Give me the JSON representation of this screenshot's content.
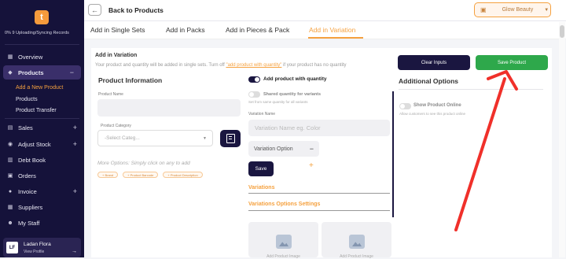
{
  "sidebar": {
    "logo_letter": "t",
    "sync_status": "0% 9 Uploading/Syncing Records",
    "items": [
      {
        "label": "Overview",
        "icon": "dashboard-icon"
      },
      {
        "label": "Products",
        "icon": "box-icon",
        "toggle": "−"
      },
      {
        "label": "Sales",
        "icon": "receipt-icon",
        "toggle": "+"
      },
      {
        "label": "Adjust Stock",
        "icon": "adjust-icon",
        "toggle": "+"
      },
      {
        "label": "Debt Book",
        "icon": "book-icon"
      },
      {
        "label": "Orders",
        "icon": "cart-icon"
      },
      {
        "label": "Invoice",
        "icon": "invoice-icon",
        "toggle": "+"
      },
      {
        "label": "Suppliers",
        "icon": "suppliers-icon"
      },
      {
        "label": "My Staff",
        "icon": "staff-icon"
      }
    ],
    "sub_items": [
      "Add a New Product",
      "Products",
      "Product Transfer"
    ],
    "user": {
      "initials": "LF",
      "name": "Ladan Flora",
      "link": "View Profile"
    }
  },
  "header": {
    "back_label": "Back to Products",
    "store": "Glow Beauty"
  },
  "tabs": [
    "Add in Single Sets",
    "Add in Packs",
    "Add in Pieces & Pack",
    "Add in Variation"
  ],
  "active_tab": 3,
  "form": {
    "title": "Add in Variation",
    "desc_before": "Your product and quantity will be added in single sets. Turn off ",
    "desc_link": "\"add product with quantity\"",
    "desc_after": " if your product has no quantity",
    "clear_label": "Clear Inputs",
    "save_label": "Save Product",
    "product_info": {
      "heading": "Product Information",
      "name_label": "Product Name",
      "category_label": "Product Category",
      "category_placeholder": "-Select Categ...",
      "more_options": "More Options: Simply click on any to add",
      "chips": [
        "+ Brand",
        "+ Product Barcode",
        "+ Product Description"
      ]
    },
    "variation": {
      "add_with_qty": "Add product with quantity",
      "shared_qty": "Shared quantity for variants",
      "shared_qty_sub": "Set from same quantity for all variants",
      "name_label": "Variation Name",
      "name_placeholder": "Variation Name eg. Color",
      "option_label": "Variation Option",
      "option_toggle": "−",
      "save_label": "Save",
      "add_symbol": "+",
      "variations_heading": "Variations",
      "options_settings_heading": "Variations Options Settings",
      "image_caption": "Add Product Image"
    },
    "additional": {
      "heading": "Additional Options",
      "show_online": "Show Product Online",
      "show_online_sub": "Allow customers to see this product online"
    }
  },
  "annotation": {
    "arrow_color": "#f0302a"
  }
}
